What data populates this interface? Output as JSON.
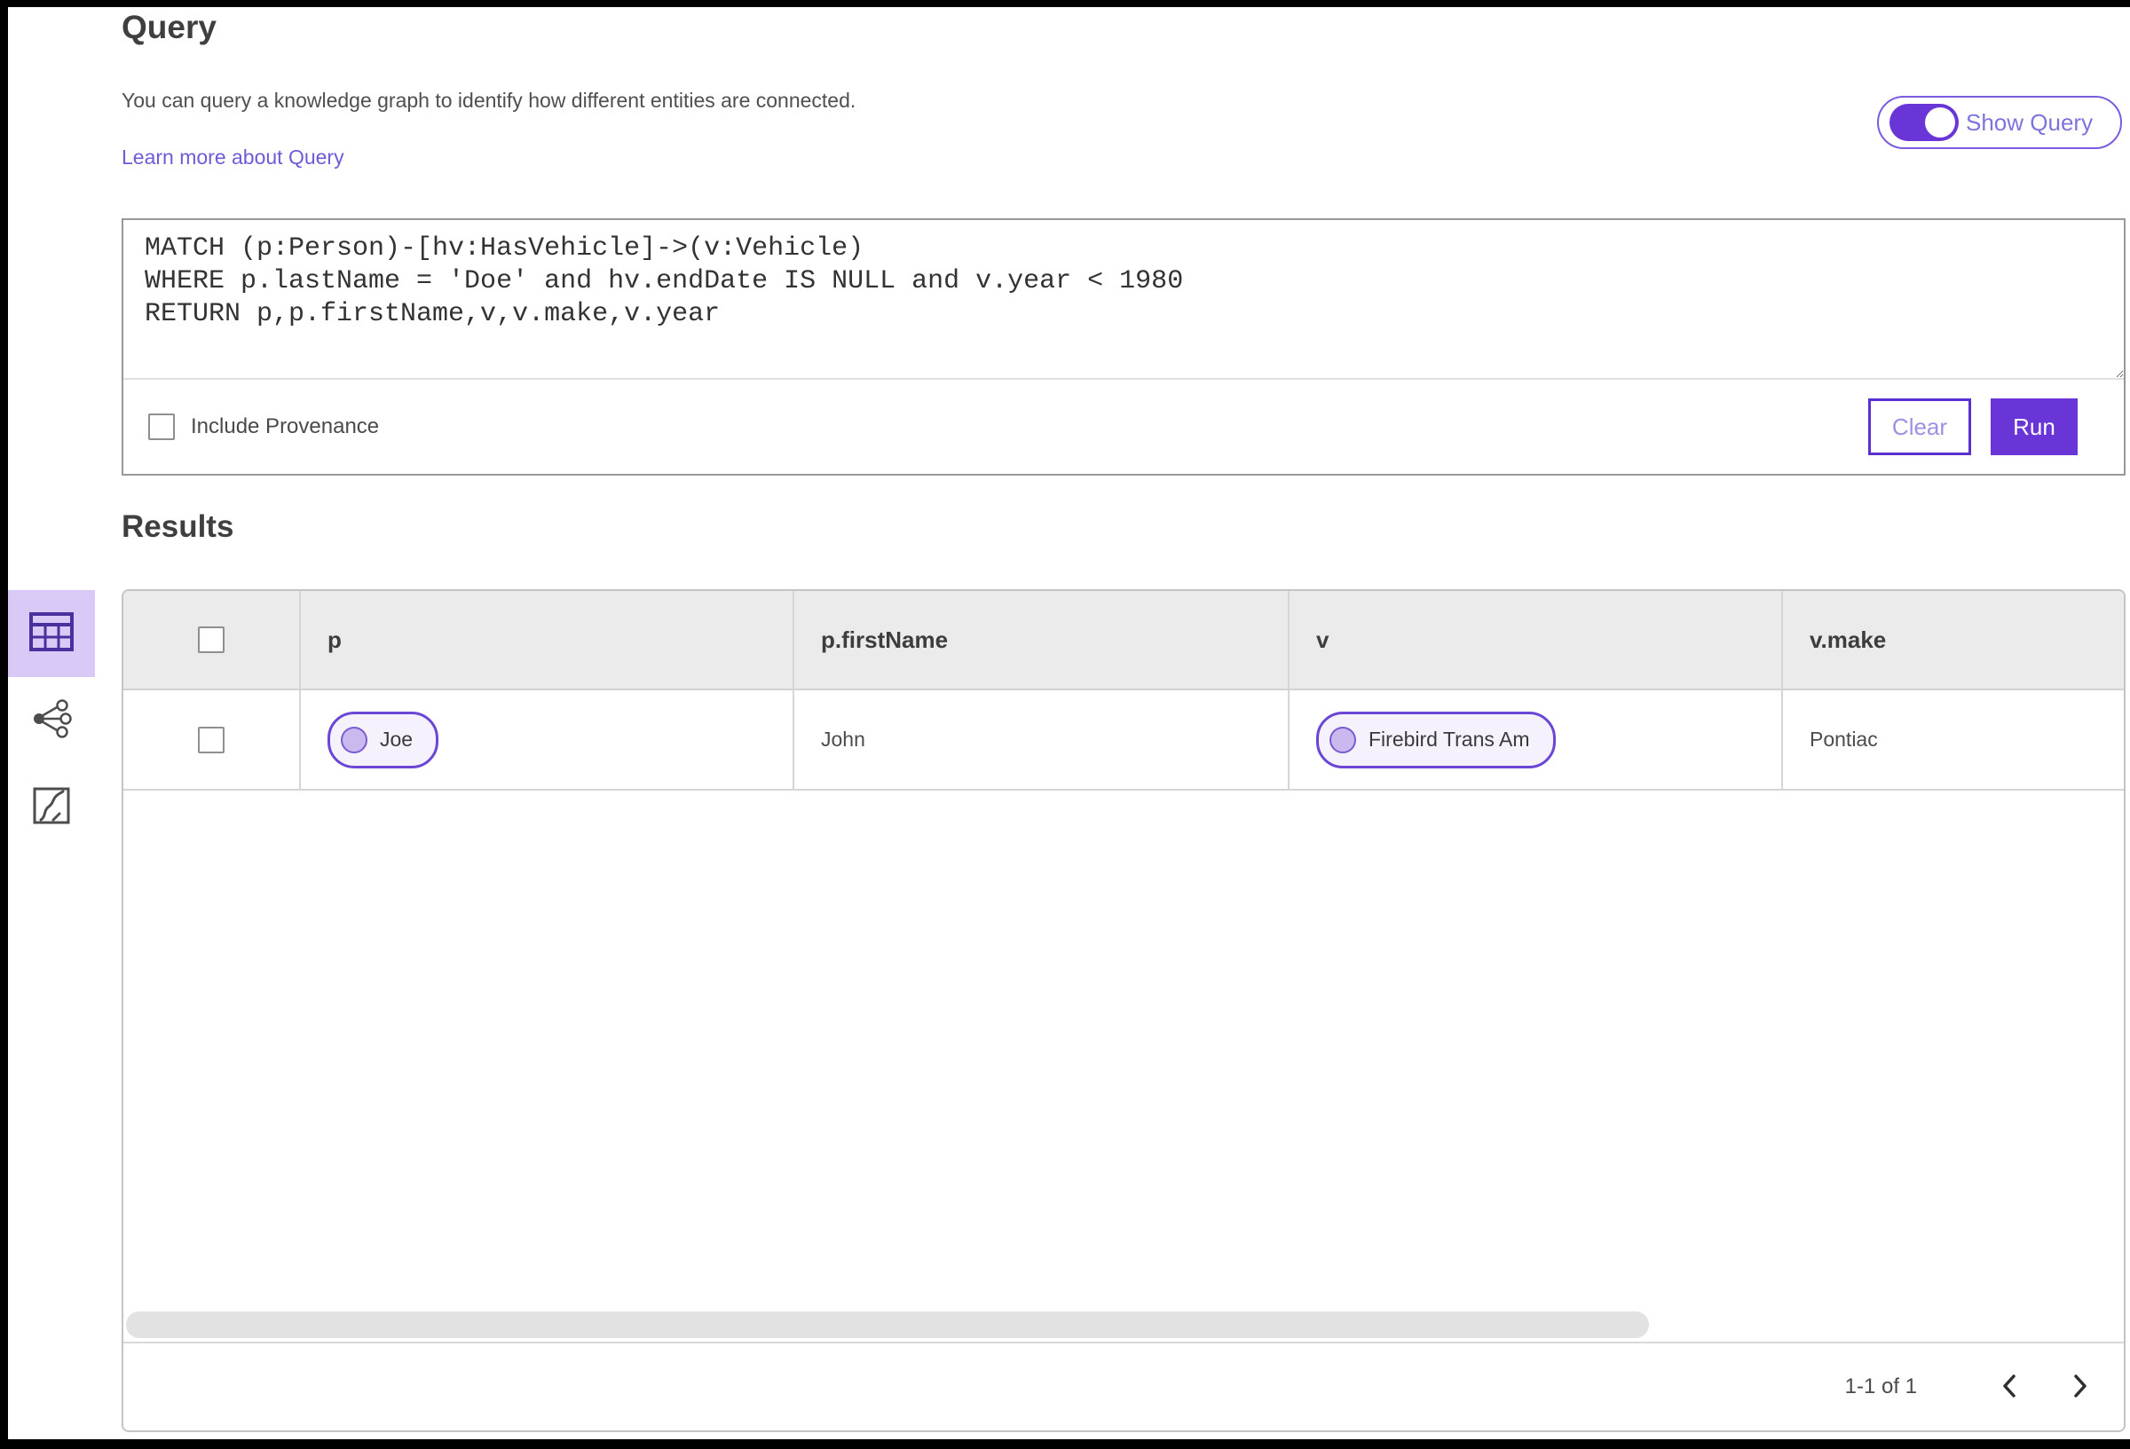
{
  "colors": {
    "accent_purple": "#6a35d6",
    "accent_light_bg": "#d9c9f6",
    "link_purple": "#6e5bd8",
    "pill_fill": "#f6f2fd"
  },
  "header": {
    "title": "Query",
    "description": "You can query a knowledge graph to identify how different entities are connected.",
    "learn_more_link": "Learn more about Query",
    "show_query_label": "Show Query",
    "show_query_on": true
  },
  "query_editor": {
    "code": "MATCH (p:Person)-[hv:HasVehicle]->(v:Vehicle)\nWHERE p.lastName = 'Doe' and hv.endDate IS NULL and v.year < 1980\nRETURN p,p.firstName,v,v.make,v.year",
    "include_provenance_label": "Include Provenance",
    "include_provenance_checked": false,
    "clear_button_label": "Clear",
    "run_button_label": "Run"
  },
  "results": {
    "title": "Results",
    "views": {
      "selected": "table-view",
      "items": [
        "table-view",
        "graph-view",
        "map-view"
      ]
    },
    "table": {
      "columns": [
        "p",
        "p.firstName",
        "v",
        "v.make"
      ],
      "rows": [
        {
          "selected": false,
          "p": "Joe",
          "p_firstName": "John",
          "v": "Firebird Trans Am",
          "v_make": "Pontiac"
        }
      ]
    },
    "pagination": {
      "range_label": "1-1 of 1"
    }
  }
}
